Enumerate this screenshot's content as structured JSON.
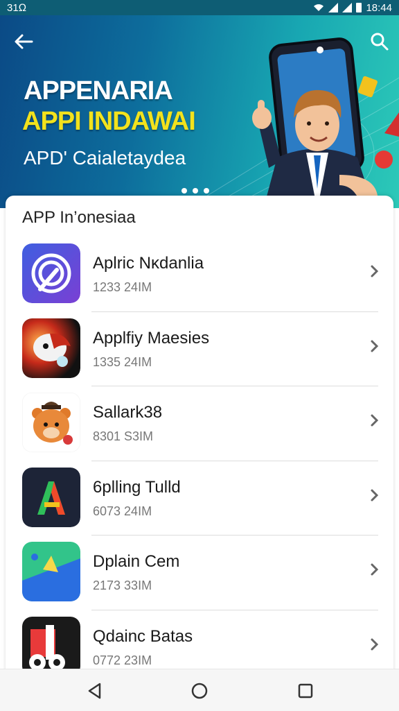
{
  "status_bar": {
    "left_text": "31Ω",
    "time": "18:44"
  },
  "header": {
    "title_line1": "APPENARIA",
    "title_line2": "APPI INDAWAI",
    "subtitle": "APD' Caialetaydea",
    "accent_color": "#f2e21d"
  },
  "section": {
    "title": "APP In’onesiaa"
  },
  "apps": [
    {
      "name": "Aplric Nĸdanlia",
      "size": "1233 24IM",
      "icon": "swirl-app-icon"
    },
    {
      "name": "Applfiy Maesies",
      "size": "1335 24IM",
      "icon": "penguin-app-icon"
    },
    {
      "name": "Sallark38",
      "size": "8301 S3IM",
      "icon": "bear-app-icon"
    },
    {
      "name": "6plling Tulld",
      "size": "6073 24IM",
      "icon": "letter-a-app-icon"
    },
    {
      "name": "Dplain Cem",
      "size": "2173 33IM",
      "icon": "map-app-icon"
    },
    {
      "name": "Qdainc Batas",
      "size": "0772 23IM",
      "icon": "music-app-icon"
    }
  ],
  "nav": {
    "back": "back-triangle-icon",
    "home": "home-circle-icon",
    "recents": "recents-square-icon"
  }
}
